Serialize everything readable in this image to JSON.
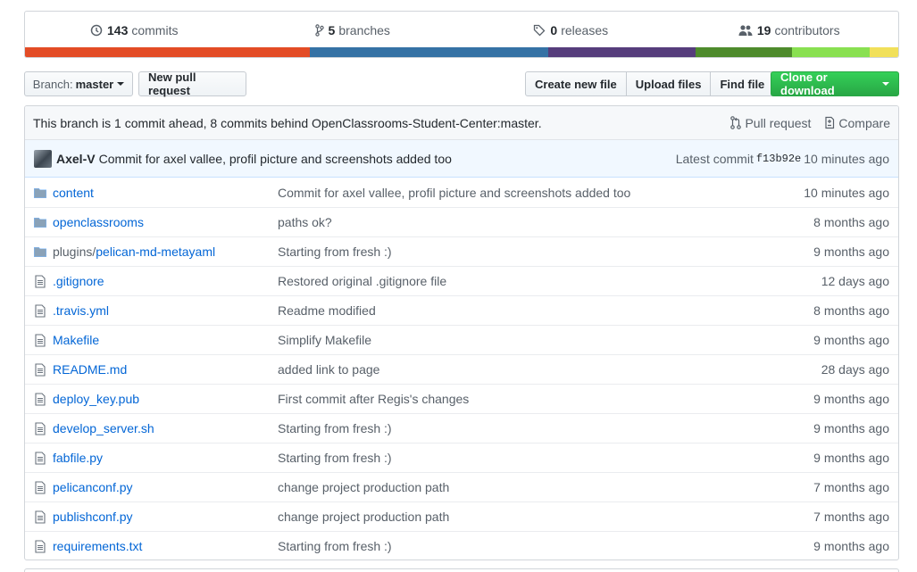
{
  "summary": {
    "commits": {
      "count": "143",
      "label": "commits"
    },
    "branches": {
      "count": "5",
      "label": "branches"
    },
    "releases": {
      "count": "0",
      "label": "releases"
    },
    "contributors": {
      "count": "19",
      "label": "contributors"
    }
  },
  "language_bar": [
    {
      "color": "#e34c26",
      "share": 32.6
    },
    {
      "color": "#3572a5",
      "share": 27.3
    },
    {
      "color": "#563d7c",
      "share": 16.9
    },
    {
      "color": "#4e8b2c",
      "share": 11.0
    },
    {
      "color": "#89e051",
      "share": 8.9
    },
    {
      "color": "#f1e05a",
      "share": 3.3
    }
  ],
  "toolbar": {
    "branch_prefix": "Branch:",
    "branch_name": "master",
    "new_pr": "New pull request",
    "create_file": "Create new file",
    "upload_files": "Upload files",
    "find_file": "Find file",
    "clone": "Clone or download"
  },
  "ahead_bar": {
    "message": "This branch is 1 commit ahead, 8 commits behind OpenClassrooms-Student-Center:master.",
    "pull_request": "Pull request",
    "compare": "Compare"
  },
  "latest_commit": {
    "author": "Axel-V",
    "message": "Commit for axel vallee, profil picture and screenshots added too",
    "prefix": "Latest commit",
    "sha": "f13b92e",
    "age": "10 minutes ago"
  },
  "files": [
    {
      "type": "folder",
      "prefix": "",
      "name": "content",
      "message": "Commit for axel vallee, profil picture and screenshots added too",
      "age": "10 minutes ago"
    },
    {
      "type": "folder",
      "prefix": "",
      "name": "openclassrooms",
      "message": "paths ok?",
      "age": "8 months ago"
    },
    {
      "type": "folder",
      "prefix": "plugins/",
      "name": "pelican-md-metayaml",
      "message": "Starting from fresh :)",
      "age": "9 months ago"
    },
    {
      "type": "file",
      "prefix": "",
      "name": ".gitignore",
      "message": "Restored original .gitignore file",
      "age": "12 days ago"
    },
    {
      "type": "file",
      "prefix": "",
      "name": ".travis.yml",
      "message": "Readme modified",
      "age": "8 months ago"
    },
    {
      "type": "file",
      "prefix": "",
      "name": "Makefile",
      "message": "Simplify Makefile",
      "age": "9 months ago"
    },
    {
      "type": "file",
      "prefix": "",
      "name": "README.md",
      "message": "added link to page",
      "age": "28 days ago"
    },
    {
      "type": "file",
      "prefix": "",
      "name": "deploy_key.pub",
      "message": "First commit after Regis's changes",
      "age": "9 months ago"
    },
    {
      "type": "file",
      "prefix": "",
      "name": "develop_server.sh",
      "message": "Starting from fresh :)",
      "age": "9 months ago"
    },
    {
      "type": "file",
      "prefix": "",
      "name": "fabfile.py",
      "message": "Starting from fresh :)",
      "age": "9 months ago"
    },
    {
      "type": "file",
      "prefix": "",
      "name": "pelicanconf.py",
      "message": "change project production path",
      "age": "7 months ago"
    },
    {
      "type": "file",
      "prefix": "",
      "name": "publishconf.py",
      "message": "change project production path",
      "age": "7 months ago"
    },
    {
      "type": "file",
      "prefix": "",
      "name": "requirements.txt",
      "message": "Starting from fresh :)",
      "age": "9 months ago"
    }
  ]
}
